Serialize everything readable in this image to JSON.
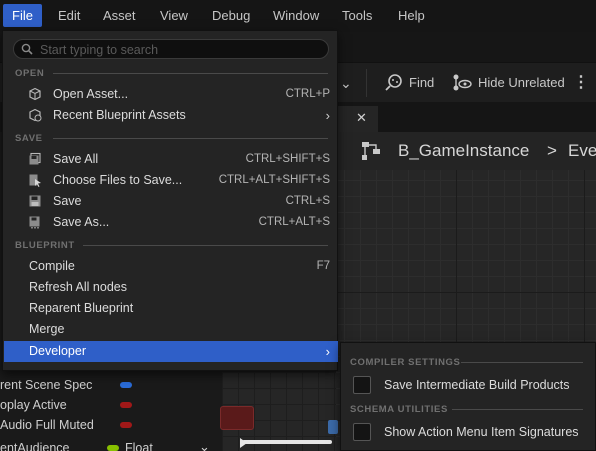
{
  "menubar": {
    "items": [
      "File",
      "Edit",
      "Asset",
      "View",
      "Debug",
      "Window",
      "Tools",
      "Help"
    ],
    "active": "File"
  },
  "toolbar": {
    "find_label": "Find",
    "hide_unrelated_label": "Hide Unrelated"
  },
  "breadcrumb": {
    "asset": "B_GameInstance",
    "separator": ">",
    "graph": "Eve"
  },
  "file_menu": {
    "search_placeholder": "Start typing to search",
    "sections": {
      "open": "OPEN",
      "save": "SAVE",
      "blueprint": "BLUEPRINT"
    },
    "open_items": [
      {
        "label": "Open Asset...",
        "shortcut": "CTRL+P",
        "icon": "open-asset-icon"
      },
      {
        "label": "Recent Blueprint Assets",
        "shortcut": "",
        "icon": "recent-assets-icon"
      }
    ],
    "save_items": [
      {
        "label": "Save All",
        "shortcut": "CTRL+SHIFT+S",
        "icon": "save-all-icon"
      },
      {
        "label": "Choose Files to Save...",
        "shortcut": "CTRL+ALT+SHIFT+S",
        "icon": "choose-files-icon"
      },
      {
        "label": "Save",
        "shortcut": "CTRL+S",
        "icon": "save-icon"
      },
      {
        "label": "Save As...",
        "shortcut": "CTRL+ALT+S",
        "icon": "save-as-icon"
      }
    ],
    "blueprint_items": [
      {
        "label": "Compile",
        "shortcut": "F7"
      },
      {
        "label": "Refresh All nodes",
        "shortcut": ""
      },
      {
        "label": "Reparent Blueprint",
        "shortcut": ""
      },
      {
        "label": "Merge",
        "shortcut": ""
      },
      {
        "label": "Developer",
        "shortcut": ""
      }
    ]
  },
  "developer_submenu": {
    "sections": {
      "compiler": "COMPILER SETTINGS",
      "schema": "SCHEMA UTILITIES"
    },
    "items": [
      {
        "label": "Save Intermediate Build Products",
        "checked": false
      },
      {
        "label": "Show Action Menu Item Signatures",
        "checked": false
      }
    ]
  },
  "variables": [
    {
      "label": "rent Scene Spec",
      "color": "#2a6bd6"
    },
    {
      "label": "oplay Active",
      "color": "#a01818"
    },
    {
      "label": "Audio Full Muted",
      "color": "#a01818"
    },
    {
      "label": "entAudience",
      "color": "#88c000",
      "type": "Float"
    }
  ],
  "colors": {
    "highlight": "#2f5fc8",
    "menu_bg": "#242424"
  }
}
